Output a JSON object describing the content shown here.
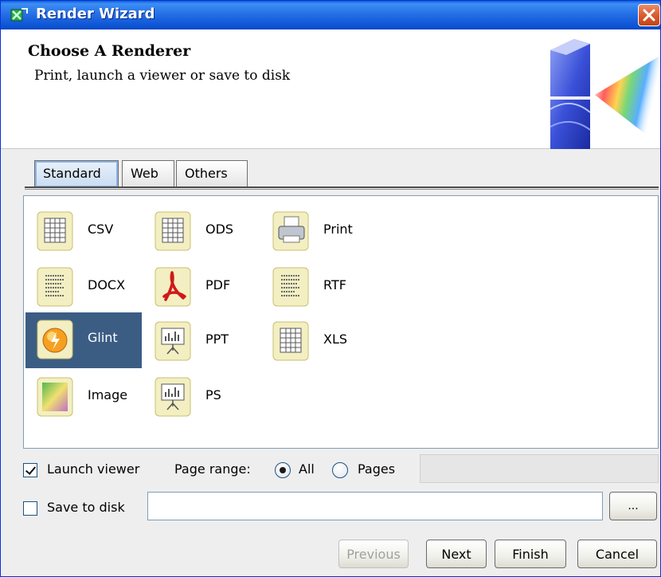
{
  "window": {
    "title": "Render Wizard"
  },
  "header": {
    "title": "Choose A Renderer",
    "subtitle": "Print, launch a viewer or save to disk"
  },
  "tabs": [
    {
      "label": "Standard",
      "selected": true
    },
    {
      "label": "Web",
      "selected": false
    },
    {
      "label": "Others",
      "selected": false
    }
  ],
  "renderers": {
    "csv": {
      "label": "CSV",
      "icon": "spreadsheet-icon"
    },
    "ods": {
      "label": "ODS",
      "icon": "spreadsheet-icon"
    },
    "print": {
      "label": "Print",
      "icon": "printer-icon"
    },
    "docx": {
      "label": "DOCX",
      "icon": "document-icon"
    },
    "pdf": {
      "label": "PDF",
      "icon": "pdf-icon"
    },
    "rtf": {
      "label": "RTF",
      "icon": "document-icon"
    },
    "glint": {
      "label": "Glint",
      "icon": "glint-icon",
      "selected": true
    },
    "ppt": {
      "label": "PPT",
      "icon": "presentation-icon"
    },
    "xls": {
      "label": "XLS",
      "icon": "spreadsheet-icon"
    },
    "image": {
      "label": "Image",
      "icon": "image-icon"
    },
    "ps": {
      "label": "PS",
      "icon": "presentation-icon"
    }
  },
  "options": {
    "launch_viewer": {
      "label": "Launch viewer",
      "checked": true
    },
    "page_range": {
      "label": "Page range:",
      "all_label": "All",
      "pages_label": "Pages",
      "selected": "All",
      "pages_value": ""
    },
    "save_to_disk": {
      "label": "Save to disk",
      "checked": false,
      "path_value": ""
    },
    "browse_label": "..."
  },
  "buttons": {
    "previous": "Previous",
    "next": "Next",
    "finish": "Finish",
    "cancel": "Cancel"
  },
  "colors": {
    "titlebar": "#0a5fd6",
    "selection": "#3b5d84",
    "close": "#d8582c"
  }
}
